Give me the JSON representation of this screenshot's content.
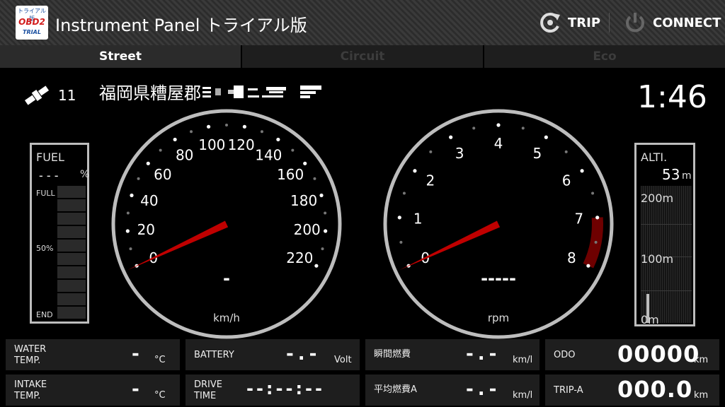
{
  "header": {
    "logo": {
      "line1": "トライアル版",
      "line2": "OBD2",
      "line3": "TRIAL"
    },
    "title": "Instrument Panel トライアル版",
    "trip_label": "TRIP",
    "connect_label": "CONNECT",
    "trip_icon": "refresh-c-icon",
    "connect_icon": "power-icon"
  },
  "tabs": [
    {
      "label": "Street",
      "active": true
    },
    {
      "label": "Circuit",
      "active": false
    },
    {
      "label": "Eco",
      "active": false
    }
  ],
  "gps": {
    "icon": "satellite-icon",
    "count": "11"
  },
  "address": "福岡県糟屋郡",
  "clock": "1:46",
  "fuel": {
    "label": "FUEL",
    "value": "- - -",
    "unit": "%",
    "full": "FULL",
    "half": "50%",
    "end": "END",
    "level": 0
  },
  "speedometer": {
    "ticks": [
      "0",
      "20",
      "40",
      "60",
      "80",
      "100",
      "120",
      "140",
      "160",
      "180",
      "200",
      "220"
    ],
    "value_text": "-",
    "unit": "km/h",
    "needle_value": 0
  },
  "tachometer": {
    "ticks": [
      "0",
      "1",
      "2",
      "3",
      "4",
      "5",
      "6",
      "7",
      "8"
    ],
    "value_text": "-----",
    "unit": "rpm",
    "needle_value": 0,
    "redline_start": 7
  },
  "altitude": {
    "label": "ALTI.",
    "value": "53",
    "unit": "m",
    "levels": [
      "200m",
      "100m",
      "0m"
    ],
    "current": 53
  },
  "colors": {
    "needle": "#c00000",
    "redzone": "#6e0000",
    "bezel": "#bdbdbd",
    "panel": "#1e1e1e"
  },
  "cells": {
    "water_temp": {
      "label1": "WATER",
      "label2": "TEMP.",
      "value": "-",
      "unit": "°C"
    },
    "battery": {
      "label": "BATTERY",
      "value": "-.-",
      "unit": "Volt"
    },
    "inst_fuel": {
      "label": "瞬間燃費",
      "value": "-.-",
      "unit": "km/l"
    },
    "odo": {
      "label": "ODO",
      "value": "00000",
      "unit": "km"
    },
    "intake_temp": {
      "label1": "INTAKE",
      "label2": "TEMP.",
      "value": "-",
      "unit": "°C"
    },
    "drive_time": {
      "label1": "DRIVE",
      "label2": "TIME",
      "value": "--:--:--"
    },
    "avg_fuel": {
      "label": "平均燃費A",
      "value": "-.-",
      "unit": "km/l"
    },
    "trip_a": {
      "label": "TRIP-A",
      "value": "000.0",
      "unit": "km"
    }
  }
}
